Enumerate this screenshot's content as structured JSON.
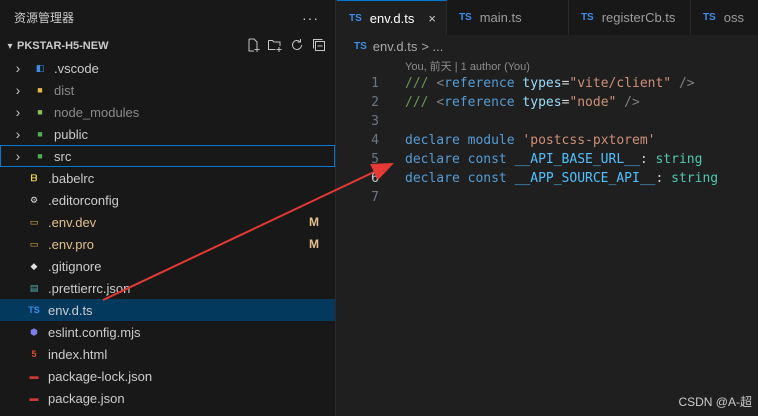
{
  "sidebar": {
    "title": "资源管理器",
    "more": "···",
    "project": "PKSTAR-H5-NEW",
    "items": [
      {
        "label": ".vscode",
        "kind": "folder",
        "icon": "vscode-folder-icon",
        "color": "#3b8eea"
      },
      {
        "label": "dist",
        "kind": "folder",
        "icon": "dist-folder-icon",
        "color": "#e8b84a",
        "dim": true
      },
      {
        "label": "node_modules",
        "kind": "folder",
        "icon": "node-modules-folder-icon",
        "color": "#8bc34a",
        "dim": true
      },
      {
        "label": "public",
        "kind": "folder",
        "icon": "public-folder-icon",
        "color": "#4caf50"
      },
      {
        "label": "src",
        "kind": "folder",
        "icon": "src-folder-icon",
        "color": "#4caf50",
        "focused": true
      },
      {
        "label": ".babelrc",
        "kind": "file",
        "icon": "babel-file-icon",
        "color": "#f5da55"
      },
      {
        "label": ".editorconfig",
        "kind": "file",
        "icon": "editorconfig-file-icon",
        "color": "#e0e0e0"
      },
      {
        "label": ".env.dev",
        "kind": "file",
        "icon": "env-file-icon",
        "color": "#e8b84a",
        "badge": "M"
      },
      {
        "label": ".env.pro",
        "kind": "file",
        "icon": "env-file-icon",
        "color": "#e8b84a",
        "badge": "M"
      },
      {
        "label": ".gitignore",
        "kind": "file",
        "icon": "git-file-icon",
        "color": "#e0e0e0"
      },
      {
        "label": ".prettierrc.json",
        "kind": "file",
        "icon": "prettier-file-icon",
        "color": "#56b3b4"
      },
      {
        "label": "env.d.ts",
        "kind": "file",
        "icon": "typescript-file-icon",
        "color": "#3b8eea",
        "selected": true
      },
      {
        "label": "eslint.config.mjs",
        "kind": "file",
        "icon": "eslint-file-icon",
        "color": "#7c7cea"
      },
      {
        "label": "index.html",
        "kind": "file",
        "icon": "html-file-icon",
        "color": "#e44d26"
      },
      {
        "label": "package-lock.json",
        "kind": "file",
        "icon": "npm-file-icon",
        "color": "#cb3837"
      },
      {
        "label": "package.json",
        "kind": "file",
        "icon": "npm-file-icon",
        "color": "#cb3837"
      }
    ]
  },
  "tabs": [
    {
      "label": "env.d.ts",
      "icon_text": "TS",
      "active": true,
      "close": "×"
    },
    {
      "label": "main.ts",
      "icon_text": "TS"
    },
    {
      "label": "registerCb.ts",
      "icon_text": "TS"
    },
    {
      "label": "oss",
      "icon_text": "TS"
    }
  ],
  "breadcrumb": {
    "icon_text": "TS",
    "file": "env.d.ts",
    "rest": "> ..."
  },
  "blame": "You, 前天 | 1 author (You)",
  "code": {
    "line_numbers": [
      "1",
      "2",
      "3",
      "4",
      "5",
      "6",
      "7"
    ],
    "l1": {
      "slashes": "/// ",
      "open": "<",
      "tag": "reference",
      "attr": "types",
      "eq": "=",
      "str": "\"vite/client\"",
      "close": " />"
    },
    "l2": {
      "slashes": "/// ",
      "open": "<",
      "tag": "reference",
      "attr": "types",
      "eq": "=",
      "str": "\"node\"",
      "close": " />"
    },
    "l4": {
      "kw1": "declare",
      "kw2": "module",
      "str": "'postcss-pxtorem'"
    },
    "l5": {
      "kw1": "declare",
      "kw2": "const",
      "var": "__API_BASE_URL__",
      "colon": ":",
      "type": "string"
    },
    "l6": {
      "kw1": "declare",
      "kw2": "const",
      "var": "__APP_SOURCE_API__",
      "colon": ":",
      "type": "string"
    }
  },
  "watermark": "CSDN @A-超"
}
